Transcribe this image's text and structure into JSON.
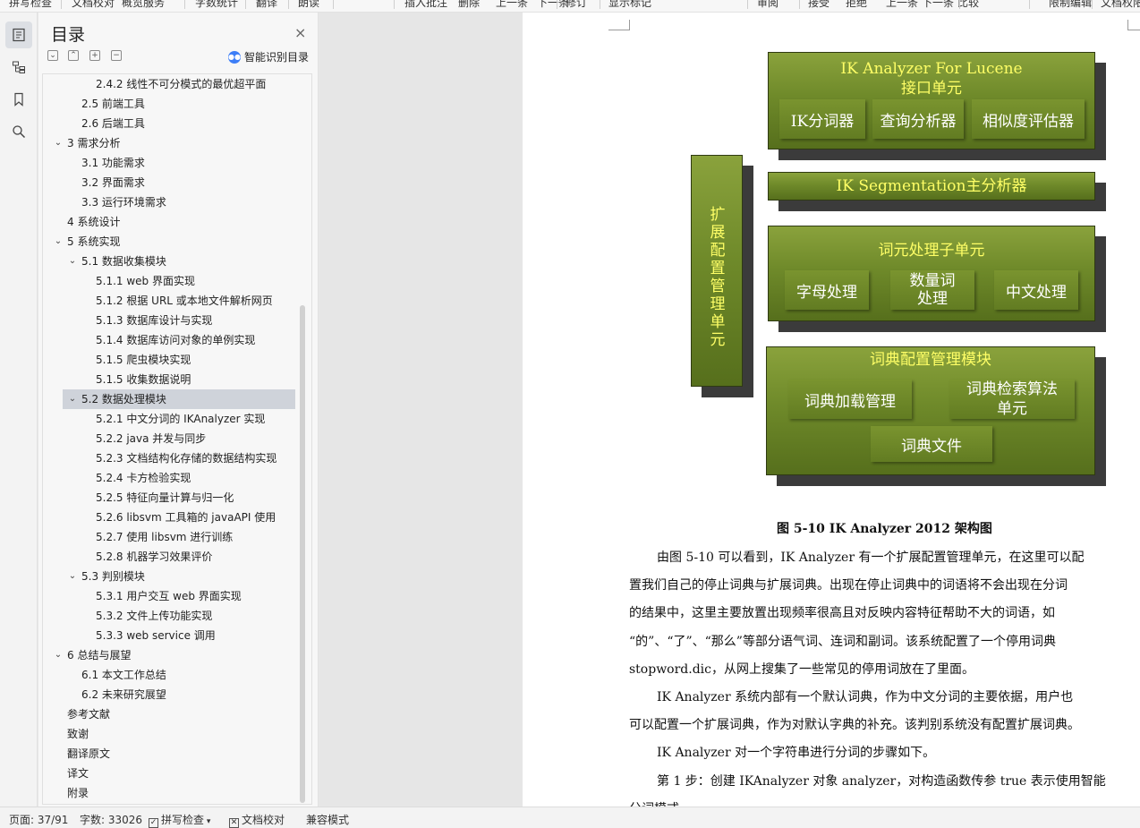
{
  "toolbar": {
    "items": [
      "拼写检查",
      "文档校对",
      "概览服务",
      "字数统计",
      "翻译",
      "朗读",
      "插入批注",
      "删除",
      "上一条",
      "下一条",
      "修订",
      "显示标记",
      "审阅",
      "接受",
      "拒绝",
      "上一条",
      "下一条",
      "比较",
      "限制编辑",
      "文档权限"
    ]
  },
  "rail": {
    "icons": [
      "toc-icon",
      "outline-icon",
      "bookmark-icon",
      "search-icon"
    ]
  },
  "toc": {
    "title": "目录",
    "close": "×",
    "controls": [
      "⌄",
      "⌃",
      "+",
      "−"
    ],
    "smart_label": "智能识别目录",
    "items": [
      {
        "label": "2.4.2 线性不可分模式的最优超平面",
        "level": 3,
        "chev": ""
      },
      {
        "label": "2.5  前端工具",
        "level": 2,
        "chev": ""
      },
      {
        "label": "2.6  后端工具",
        "level": 2,
        "chev": ""
      },
      {
        "label": "3 需求分析",
        "level": 1,
        "chev": "⌄"
      },
      {
        "label": "3.1  功能需求",
        "level": 2,
        "chev": ""
      },
      {
        "label": "3.2  界面需求",
        "level": 2,
        "chev": ""
      },
      {
        "label": "3.3 运行环境需求",
        "level": 2,
        "chev": ""
      },
      {
        "label": "4 系统设计",
        "level": 1,
        "chev": ""
      },
      {
        "label": "5 系统实现",
        "level": 1,
        "chev": "⌄"
      },
      {
        "label": "5.1  数据收集模块",
        "level": 2,
        "chev": "⌄"
      },
      {
        "label": "5.1.1 web  界面实现",
        "level": 3,
        "chev": ""
      },
      {
        "label": "5.1.2  根据 URL 或本地文件解析网页",
        "level": 3,
        "chev": ""
      },
      {
        "label": "5.1.3  数据库设计与实现",
        "level": 3,
        "chev": ""
      },
      {
        "label": "5.1.4  数据库访问对象的单例实现",
        "level": 3,
        "chev": ""
      },
      {
        "label": "5.1.5  爬虫模块实现",
        "level": 3,
        "chev": ""
      },
      {
        "label": "5.1.5  收集数据说明",
        "level": 3,
        "chev": ""
      },
      {
        "label": "5.2  数据处理模块",
        "level": 2,
        "chev": "⌄",
        "selected": true
      },
      {
        "label": "5.2.1 中文分词的 IKAnalyzer 实现",
        "level": 3,
        "chev": ""
      },
      {
        "label": "5.2.2 java  并发与同步",
        "level": 3,
        "chev": ""
      },
      {
        "label": "5.2.3  文档结构化存储的数据结构实现",
        "level": 3,
        "chev": ""
      },
      {
        "label": "5.2.4 卡方检验实现",
        "level": 3,
        "chev": ""
      },
      {
        "label": "5.2.5  特征向量计算与归一化",
        "level": 3,
        "chev": ""
      },
      {
        "label": "5.2.6 libsvm 工具箱的 javaAPI 使用",
        "level": 3,
        "chev": ""
      },
      {
        "label": "5.2.7  使用 libsvm 进行训练",
        "level": 3,
        "chev": ""
      },
      {
        "label": "5.2.8  机器学习效果评价",
        "level": 3,
        "chev": ""
      },
      {
        "label": "5.3 判别模块",
        "level": 2,
        "chev": "⌄"
      },
      {
        "label": "5.3.1 用户交互 web 界面实现",
        "level": 3,
        "chev": ""
      },
      {
        "label": "5.3.2  文件上传功能实现",
        "level": 3,
        "chev": ""
      },
      {
        "label": "5.3.3 web service 调用",
        "level": 3,
        "chev": ""
      },
      {
        "label": "6 总结与展望",
        "level": 1,
        "chev": "⌄"
      },
      {
        "label": "6.1  本文工作总结",
        "level": 2,
        "chev": ""
      },
      {
        "label": "6.2  未来研究展望",
        "level": 2,
        "chev": ""
      },
      {
        "label": "参考文献",
        "level": 1,
        "chev": ""
      },
      {
        "label": "致谢",
        "level": 1,
        "chev": ""
      },
      {
        "label": "翻译原文",
        "level": 1,
        "chev": ""
      },
      {
        "label": "译文",
        "level": 1,
        "chev": ""
      },
      {
        "label": "附录",
        "level": 1,
        "chev": ""
      }
    ]
  },
  "diagram": {
    "interface_title_1": "IK Analyzer For Lucene",
    "interface_title_2": "接口单元",
    "interface_subs": [
      "IK分词器",
      "查询分析器",
      "相似度评估器"
    ],
    "ext_config": "扩展配置管理单元",
    "segmentation": "IK Segmentation主分析器",
    "lexeme_title": "词元处理子单元",
    "lexeme_subs": [
      "字母处理",
      "数量词\n处理",
      "中文处理"
    ],
    "dict_title": "词典配置管理模块",
    "dict_subs": [
      "词典加载管理",
      "词典检索算法\n单元",
      "词典文件"
    ]
  },
  "document": {
    "caption": "图 5-10 IK Analyzer 2012 架构图",
    "lines": [
      "由图 5-10 可以看到，IK Analyzer 有一个扩展配置管理单元，在这里可以配",
      "置我们自己的停止词典与扩展词典。出现在停止词典中的词语将不会出现在分词",
      "的结果中，这里主要放置出现频率很高且对反映内容特征帮助不大的词语，如",
      "“的”、“了”、“那么”等部分语气词、连词和副词。该系统配置了一个停用词典",
      "stopword.dic，从网上搜集了一些常见的停用词放在了里面。",
      "IK Analyzer 系统内部有一个默认词典，作为中文分词的主要依据，用户也",
      "可以配置一个扩展词典，作为对默认字典的补充。该判别系统没有配置扩展词典。",
      "IK Analyzer 对一个字符串进行分词的步骤如下。",
      "第 1 步：创建 IKAnalyzer 对象 analyzer，对构造函数传参 true 表示使用智能",
      "分词模式。"
    ]
  },
  "status": {
    "page": "页面: 37/91",
    "words": "字数: 33026",
    "spell": "拼写检查",
    "proof": "文档校对",
    "compat": "兼容模式"
  }
}
